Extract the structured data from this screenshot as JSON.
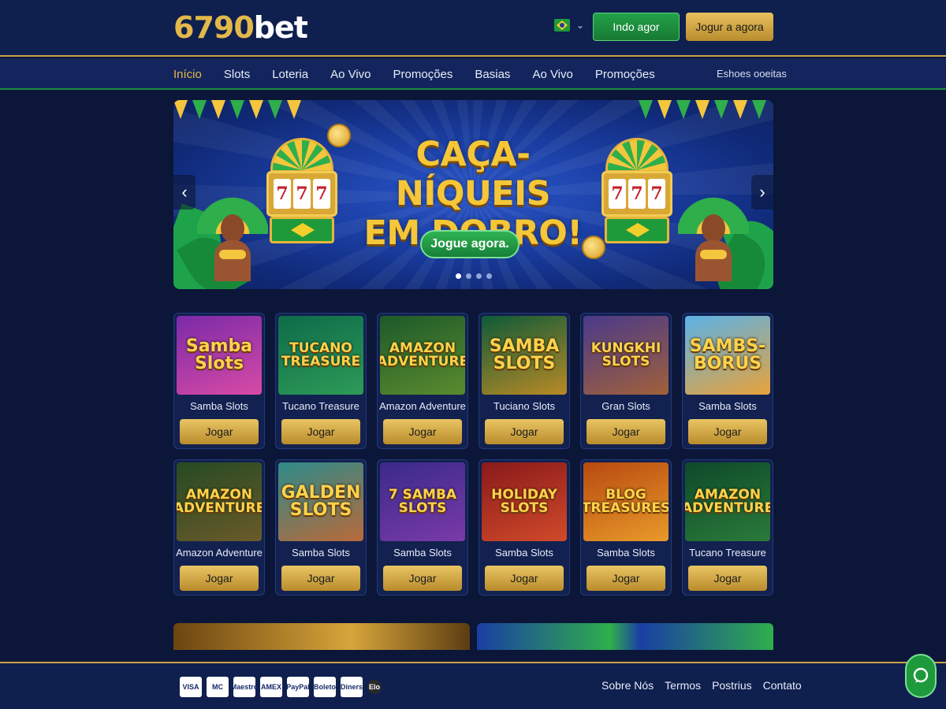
{
  "header": {
    "logo_number": "6790",
    "logo_text": "bet",
    "language_icon": "brazil-flag-icon",
    "login_label": "Indo agor",
    "play_now_label": "Jogur a agora"
  },
  "nav": {
    "items": [
      {
        "label": "Início",
        "active": true
      },
      {
        "label": "Slots"
      },
      {
        "label": "Loteria"
      },
      {
        "label": "Ao Vivo"
      },
      {
        "label": "Promoções"
      },
      {
        "label": "Basias"
      },
      {
        "label": "Ao Vivo"
      },
      {
        "label": "Promoções"
      }
    ],
    "right_link": "Eshoes ooeitas"
  },
  "banner": {
    "title_line1": "CAÇA-NÍQUEIS",
    "title_line2": "EM DOBRO!",
    "cta": "Jogue agora.",
    "slides": 4,
    "active_slide": 1,
    "reel_symbol": "7"
  },
  "games": [
    {
      "name": "Samba Slots",
      "art": "Samba Slots",
      "bg1": "#7a2aa8",
      "bg2": "#d84aa5",
      "play": "Jogar"
    },
    {
      "name": "Tucano Treasure",
      "art": "TUCANO TREASURE",
      "bg1": "#0e6b4a",
      "bg2": "#2d9b57",
      "play": "Jogar"
    },
    {
      "name": "Amazon Adventure",
      "art": "AMAZON ADVENTURE",
      "bg1": "#1d5a2a",
      "bg2": "#5b8b2e",
      "play": "Jogar"
    },
    {
      "name": "Tuciano Slots",
      "art": "SAMBA SLOTS",
      "bg1": "#0f5a38",
      "bg2": "#b98a26",
      "play": "Jogar"
    },
    {
      "name": "Gran Slots",
      "art": "KUNGKHI SLOTS",
      "bg1": "#4a3a8a",
      "bg2": "#a0603a",
      "play": "Jogar"
    },
    {
      "name": "Samba Slots",
      "art": "SAMBS-BORUS",
      "bg1": "#5ab2e8",
      "bg2": "#e8a23a",
      "play": "Jogar"
    },
    {
      "name": "Amazon Adventure",
      "art": "AMAZON ADVENTURE",
      "bg1": "#264a22",
      "bg2": "#6a5a2a",
      "play": "Jogar"
    },
    {
      "name": "Samba Slots",
      "art": "GALDEN SLOTS",
      "bg1": "#2e8a8a",
      "bg2": "#b86a3a",
      "play": "Jogar"
    },
    {
      "name": "Samba Slots",
      "art": "7 SAMBA SLOTS",
      "bg1": "#3a2a8a",
      "bg2": "#7a3aa8",
      "play": "Jogar"
    },
    {
      "name": "Samba Slots",
      "art": "HOLIDAY SLOTS",
      "bg1": "#8a1a1a",
      "bg2": "#d04a2a",
      "play": "Jogar"
    },
    {
      "name": "Samba Slots",
      "art": "BLOG TREASURES",
      "bg1": "#b84a10",
      "bg2": "#e89a2a",
      "play": "Jogar"
    },
    {
      "name": "Tucano Treasure",
      "art": "AMAZON ADVENTURE",
      "bg1": "#0e4a2a",
      "bg2": "#2a7a3a",
      "play": "Jogar"
    }
  ],
  "footer": {
    "payments": [
      "VISA",
      "MC",
      "Maestro",
      "AMEX",
      "PayPal",
      "Boleto",
      "Diners",
      "Elo"
    ],
    "links": [
      "Sobre Nós",
      "Termos",
      "Postrius",
      "Contato"
    ],
    "chat_icon": "chat-bubble-icon"
  }
}
